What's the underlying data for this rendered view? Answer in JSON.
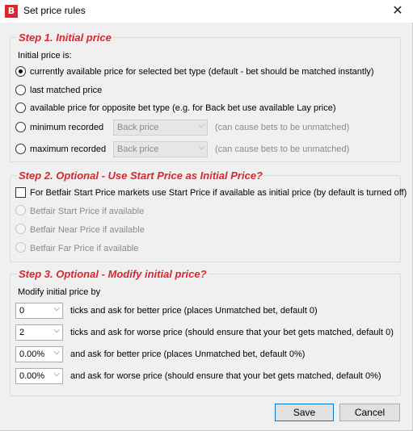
{
  "window": {
    "title": "Set price rules",
    "logo_letter": "B",
    "close_glyph": "✕"
  },
  "step1": {
    "title": "Step 1. Initial price",
    "intro": "Initial price is:",
    "options": [
      {
        "label": "currently available price for selected bet type (default - bet should be matched instantly)",
        "checked": true
      },
      {
        "label": "last matched price",
        "checked": false
      },
      {
        "label": "available price for opposite bet type (e.g. for Back bet use available Lay price)",
        "checked": false
      },
      {
        "label": "minimum recorded",
        "checked": false
      },
      {
        "label": "maximum recorded",
        "checked": false
      }
    ],
    "min_select": "Back price",
    "max_select": "Back price",
    "note": "(can cause bets to be unmatched)"
  },
  "step2": {
    "title": "Step 2. Optional - Use Start Price as Initial Price?",
    "checkbox_label": "For Betfair Start Price markets use Start Price if available as initial price (by default is turned off)",
    "options": [
      "Betfair Start Price if available",
      "Betfair Near Price if available",
      "Betfair Far Price if available"
    ]
  },
  "step3": {
    "title": "Step 3. Optional - Modify initial price?",
    "intro": "Modify initial price by",
    "rows": [
      {
        "value": "0",
        "label": "ticks and ask for better price (places Unmatched bet, default 0)"
      },
      {
        "value": "2",
        "label": "ticks and ask for worse price (should ensure that your bet gets matched, default 0)"
      },
      {
        "value": "0.00%",
        "label": "and ask for better price (places Unmatched bet, default 0%)"
      },
      {
        "value": "0.00%",
        "label": "and ask for worse price (should ensure that your bet gets matched, default 0%)"
      }
    ]
  },
  "buttons": {
    "save": "Save",
    "cancel": "Cancel"
  },
  "icons": {
    "chevron": "⌵"
  },
  "colors": {
    "accent_red": "#d8272f",
    "default_button_border": "#0078d7"
  }
}
